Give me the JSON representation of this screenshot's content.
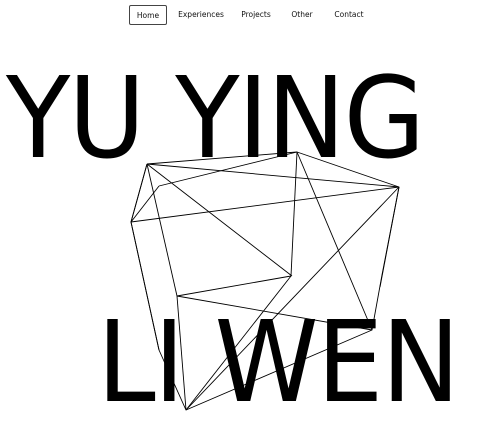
{
  "nav": {
    "items": [
      {
        "label": "Home",
        "active": true
      },
      {
        "label": "Experiences",
        "active": false
      },
      {
        "label": "Projects",
        "active": false
      },
      {
        "label": "Other",
        "active": false
      },
      {
        "label": "Contact",
        "active": false
      }
    ]
  },
  "hero": {
    "line1": "YU YING",
    "line2": "LI WEN"
  },
  "colors": {
    "background": "#ffffff",
    "text": "#000000",
    "wireframe": "#000000"
  }
}
